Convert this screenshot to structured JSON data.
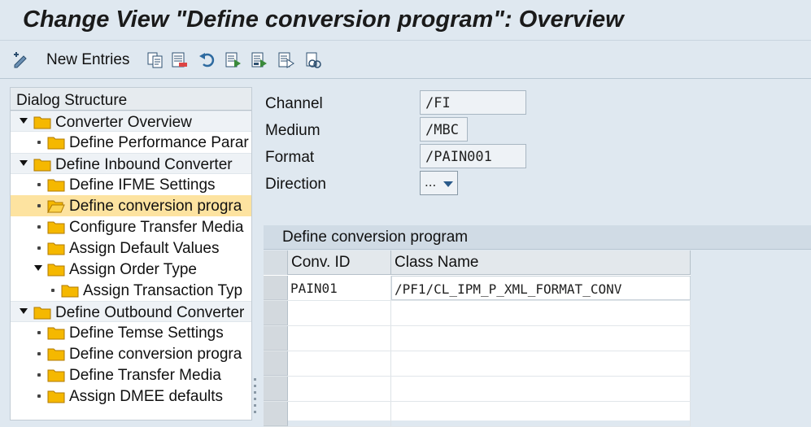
{
  "window": {
    "title": "Change View \"Define conversion program\": Overview"
  },
  "toolbar": {
    "new_entries_label": "New Entries",
    "icons": [
      "display-change-icon",
      "copy-icon",
      "delete-icon",
      "undo-icon",
      "select-all-icon",
      "select-block-icon",
      "deselect-all-icon",
      "config-icon"
    ]
  },
  "dialog_structure": {
    "header": "Dialog Structure",
    "items": [
      {
        "label": "Converter Overview",
        "level": 0,
        "expanded": true
      },
      {
        "label": "Define Performance Parar",
        "level": 1
      },
      {
        "label": "Define Inbound Converter",
        "level": 0,
        "expanded": true
      },
      {
        "label": "Define IFME Settings",
        "level": 1
      },
      {
        "label": "Define conversion progra",
        "level": 1,
        "selected": true
      },
      {
        "label": "Configure Transfer Media",
        "level": 1
      },
      {
        "label": "Assign Default Values",
        "level": 1
      },
      {
        "label": "Assign Order Type",
        "level": 1,
        "expanded": true
      },
      {
        "label": "Assign Transaction Typ",
        "level": 2
      },
      {
        "label": "Define Outbound Converter",
        "level": 0,
        "expanded": true
      },
      {
        "label": "Define Temse Settings",
        "level": 1
      },
      {
        "label": "Define conversion progra",
        "level": 1
      },
      {
        "label": "Define Transfer Media",
        "level": 1
      },
      {
        "label": "Assign DMEE defaults",
        "level": 1
      }
    ]
  },
  "fields": {
    "channel": {
      "label": "Channel",
      "value": "/FI"
    },
    "medium": {
      "label": "Medium",
      "value": "/MBC"
    },
    "format": {
      "label": "Format",
      "value": "/PAIN001"
    },
    "direction": {
      "label": "Direction",
      "value": "..."
    }
  },
  "table": {
    "title": "Define conversion program",
    "columns": [
      "Conv. ID",
      "Class Name"
    ],
    "rows": [
      [
        "PAIN01",
        "/PF1/CL_IPM_P_XML_FORMAT_CONV"
      ],
      [
        "",
        ""
      ],
      [
        "",
        ""
      ],
      [
        "",
        ""
      ],
      [
        "",
        ""
      ],
      [
        "",
        ""
      ]
    ]
  },
  "colors": {
    "background": "#dfe8f0",
    "selected_row": "#fde3a0",
    "folder": "#f5b800"
  }
}
